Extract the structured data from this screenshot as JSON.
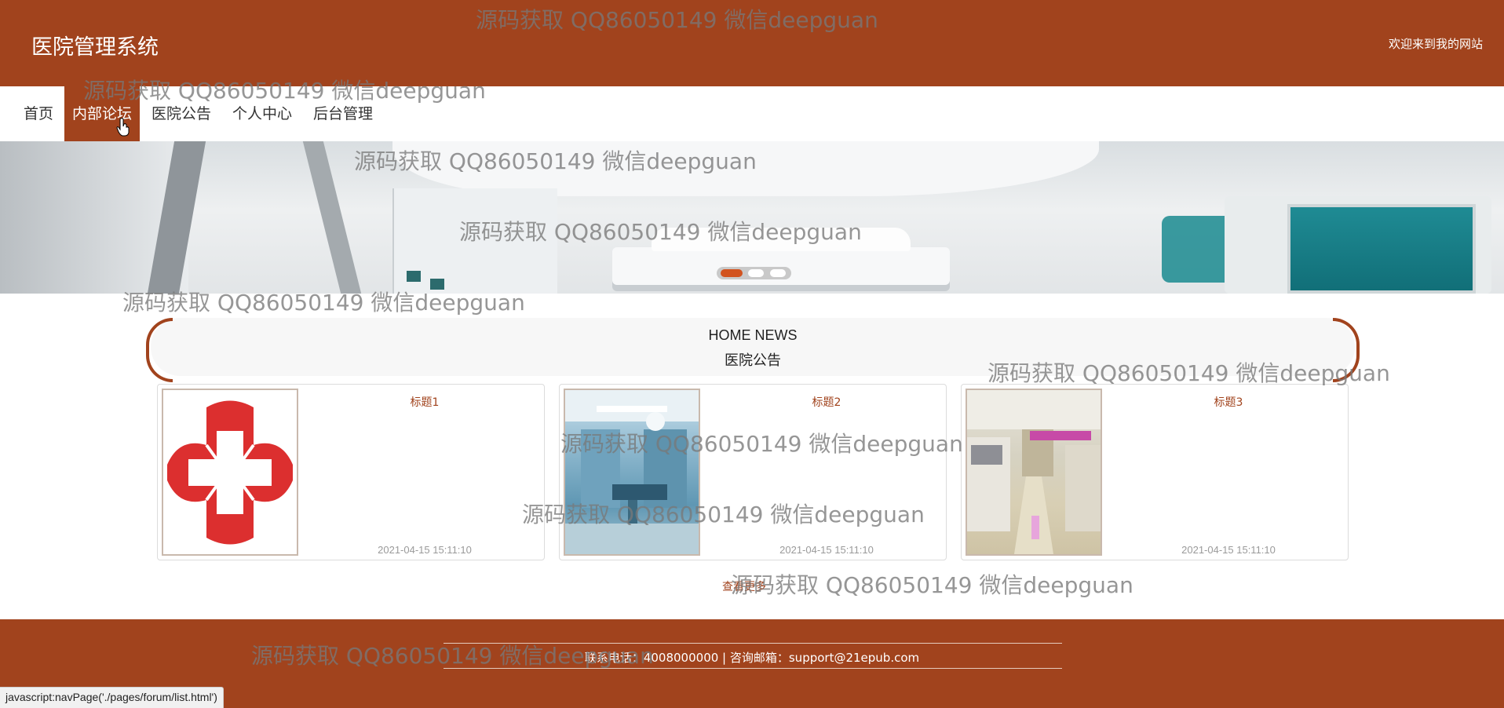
{
  "header": {
    "site_title": "医院管理系统",
    "welcome": "欢迎来到我的网站"
  },
  "nav": {
    "items": [
      {
        "label": "首页",
        "active": false
      },
      {
        "label": "内部论坛",
        "active": true
      },
      {
        "label": "医院公告",
        "active": false
      },
      {
        "label": "个人中心",
        "active": false
      },
      {
        "label": "后台管理",
        "active": false
      }
    ]
  },
  "carousel": {
    "slide_count": 3,
    "active_index": 0
  },
  "news": {
    "heading_en": "HOME NEWS",
    "heading_cn": "医院公告",
    "cards": [
      {
        "title": "标题1",
        "date": "2021-04-15 15:11:10",
        "image": "red-cross-logo"
      },
      {
        "title": "标题2",
        "date": "2021-04-15 15:11:10",
        "image": "operating-room-photo"
      },
      {
        "title": "标题3",
        "date": "2021-04-15 15:11:10",
        "image": "hospital-corridor-photo"
      }
    ],
    "more_label": "查看更多"
  },
  "footer": {
    "text": "联系电话：4008000000 | 咨询邮箱：support@21epub.com"
  },
  "statusbar": {
    "text": "javascript:navPage('./pages/forum/list.html')"
  },
  "watermark": {
    "text": "源码获取 QQ86050149 微信deepguan"
  },
  "colors": {
    "brand": "#a1431d",
    "accent_dot": "#d2531f"
  }
}
